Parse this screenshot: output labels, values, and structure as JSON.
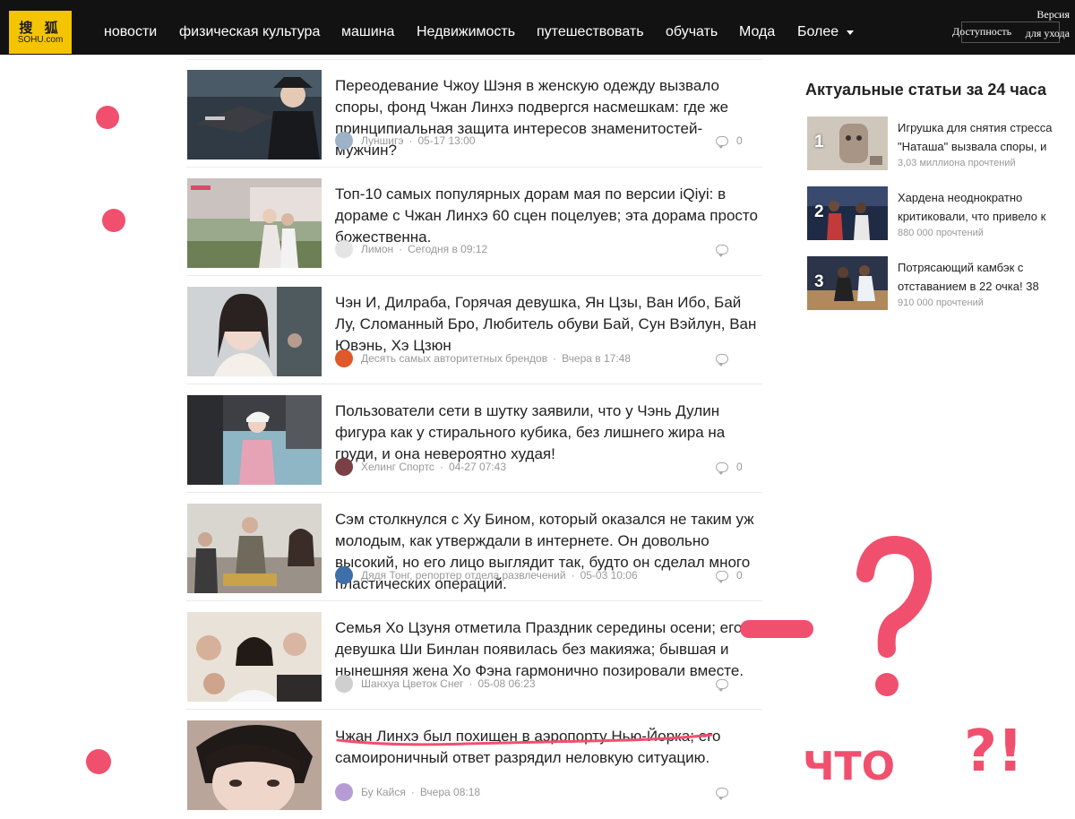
{
  "header": {
    "logo_cn": "搜 狐",
    "logo_en": "SOHU.com",
    "nav": [
      "новости",
      "физическая культура",
      "машина",
      "Недвижимость",
      "путешествовать",
      "обучать",
      "Мода",
      "Более"
    ],
    "accessibility": "Доступность",
    "elder_version": "Версия для ухода"
  },
  "feed": [
    {
      "title": "Переодевание Чжоу Шэня в женскую одежду вызвало споры, фонд Чжан Линхэ подвергся насмешкам: где же принципиальная защита интересов знаменитостей-мужчин?",
      "author": "Луншигэ",
      "time": "05-17 13:00",
      "comments": "0"
    },
    {
      "title": "Топ-10 самых популярных дорам мая по версии iQiyi: в дораме с Чжан Линхэ 60 сцен поцелуев; эта дорама просто божественна.",
      "author": "Лимон",
      "time": "Сегодня в 09:12",
      "comments": ""
    },
    {
      "title": "Чэн И, Дилраба, Горячая девушка, Ян Цзы, Ван Ибо, Бай Лу, Сломанный Бро, Любитель обуви Бай, Сун Вэйлун, Ван Ювэнь, Хэ Цзюн",
      "author": "Десять самых авторитетных брендов",
      "time": "Вчера в 17:48",
      "comments": ""
    },
    {
      "title": "Пользователи сети в шутку заявили, что у Чэнь Дулин фигура как у стирального кубика, без лишнего жира на груди, и она невероятно худая!",
      "author": "Хелинг Спортс",
      "time": "04-27 07:43",
      "comments": "0"
    },
    {
      "title": "Сэм столкнулся с Ху Бином, который оказался не таким уж молодым, как утверждали в интернете. Он довольно высокий, но его лицо выглядит так, будто он сделал много пластических операций.",
      "author": "Дядя Тонг, репортер отдела развлечений",
      "time": "05-03 10:06",
      "comments": "0"
    },
    {
      "title": "Семья Хо Цзуня отметила Праздник середины осени; его девушка Ши Бинлан появилась без макияжа; бывшая и нынешняя жена Хо Фэна гармонично позировали вместе.",
      "author": "Шанхуа Цветок Снег",
      "time": "05-08 06:23",
      "comments": ""
    },
    {
      "title": "Чжан Линхэ был похищен в аэропорту Нью-Йорка; его самоироничный ответ разрядил неловкую ситуацию.",
      "author": "Бу Кайся",
      "time": "Вчера 08:18",
      "comments": ""
    }
  ],
  "sidebar": {
    "title": "Актуальные статьи за 24 часа",
    "items": [
      {
        "rank": "1",
        "title": "Игрушка для снятия стресса \"Наташа\" вызвала споры, и",
        "reads": "3,03 миллиона прочтений"
      },
      {
        "rank": "2",
        "title": "Хардена неоднократно критиковали, что привело к",
        "reads": "880 000 прочтений"
      },
      {
        "rank": "3",
        "title": "Потрясающий камбэк с отставанием в 22 очка! 38",
        "reads": "910 000 прочтений"
      }
    ]
  },
  "annotations": {
    "handwritten_text": "ЧТО",
    "question_marks": "?!",
    "ink_color": "#f0506e"
  }
}
